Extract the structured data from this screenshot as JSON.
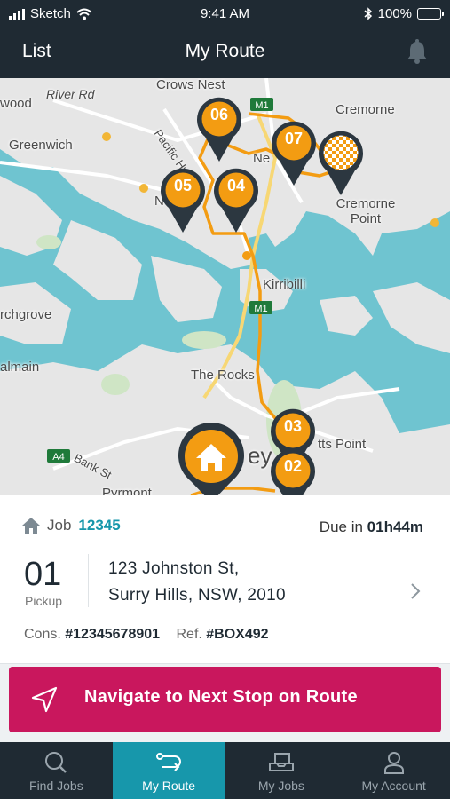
{
  "status": {
    "carrier": "Sketch",
    "time": "9:41 AM",
    "battery": "100%"
  },
  "header": {
    "left_label": "List",
    "title": "My Route"
  },
  "map": {
    "labels": {
      "crows_nest": "Crows Nest",
      "river_rd": "River Rd",
      "wood": "wood",
      "greenwich": "Greenwich",
      "cremorne": "Cremorne",
      "cremorne_point": "Cremorne Point",
      "ne": "Ne",
      "n": "N",
      "pacific_hwy": "Pacific Hwy",
      "kirribilli": "Kirribilli",
      "the_rocks": "The Rocks",
      "rchgrove": "rchgrove",
      "almain": "almain",
      "bank_st": "Bank St",
      "pyrmont": "Pyrmont",
      "potts_point": "tts Point",
      "ey": "ey",
      "m1_top": "M1",
      "m1_mid": "M1",
      "a4": "A4"
    },
    "pins": [
      {
        "label": "06"
      },
      {
        "label": "07"
      },
      {
        "label": "05"
      },
      {
        "label": "04"
      },
      {
        "label": "03"
      },
      {
        "label": "02"
      }
    ]
  },
  "job": {
    "job_label": "Job",
    "job_number": "12345",
    "due_label": "Due in",
    "due_value": "01h44m",
    "stop_number": "01",
    "stop_type": "Pickup",
    "address_line1": "123 Johnston St,",
    "address_line2": "Surry Hills, NSW, 2010",
    "cons_label": "Cons.",
    "cons_value": "#12345678901",
    "ref_label": "Ref.",
    "ref_value": "#BOX492"
  },
  "navigate_button": {
    "label": "Navigate to Next Stop on Route"
  },
  "tabs": [
    {
      "label": "Find Jobs",
      "icon": "search-icon"
    },
    {
      "label": "My Route",
      "icon": "route-icon",
      "active": true
    },
    {
      "label": "My Jobs",
      "icon": "box-icon"
    },
    {
      "label": "My Account",
      "icon": "account-icon"
    }
  ],
  "colors": {
    "dark": "#1f2a33",
    "accent_teal": "#1797ab",
    "cta_pink": "#c9175d",
    "pin_orange": "#f39c12",
    "water": "#6fc4d0"
  }
}
